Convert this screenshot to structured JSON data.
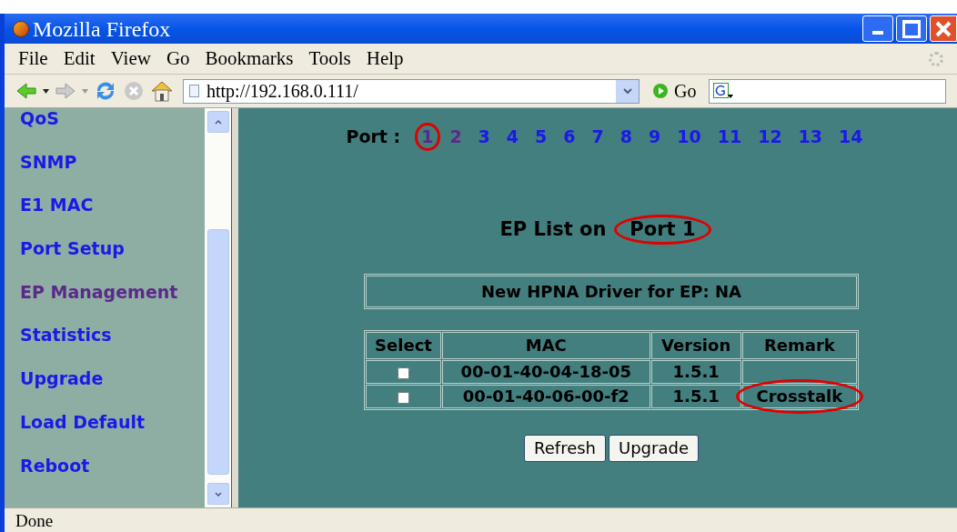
{
  "window": {
    "title": "Mozilla Firefox"
  },
  "menu": [
    "File",
    "Edit",
    "View",
    "Go",
    "Bookmarks",
    "Tools",
    "Help"
  ],
  "toolbar": {
    "url": "http://192.168.0.111/",
    "go_label": "Go"
  },
  "sidebar": {
    "items": [
      {
        "label": "QoS",
        "visited": false
      },
      {
        "label": "SNMP",
        "visited": false
      },
      {
        "label": "E1 MAC",
        "visited": false
      },
      {
        "label": "Port Setup",
        "visited": false
      },
      {
        "label": "EP Management",
        "visited": true
      },
      {
        "label": "Statistics",
        "visited": false
      },
      {
        "label": "Upgrade",
        "visited": false
      },
      {
        "label": "Load Default",
        "visited": false
      },
      {
        "label": "Reboot",
        "visited": false
      }
    ]
  },
  "ports": {
    "label": "Port :",
    "items": [
      {
        "label": "1",
        "visited": true,
        "circled": true
      },
      {
        "label": "2",
        "visited": true,
        "circled": false
      },
      {
        "label": "3",
        "visited": false,
        "circled": false
      },
      {
        "label": "4",
        "visited": false,
        "circled": false
      },
      {
        "label": "5",
        "visited": false,
        "circled": false
      },
      {
        "label": "6",
        "visited": false,
        "circled": false
      },
      {
        "label": "7",
        "visited": false,
        "circled": false
      },
      {
        "label": "8",
        "visited": false,
        "circled": false
      },
      {
        "label": "9",
        "visited": false,
        "circled": false
      },
      {
        "label": "10",
        "visited": false,
        "circled": false
      },
      {
        "label": "11",
        "visited": false,
        "circled": false
      },
      {
        "label": "12",
        "visited": false,
        "circled": false
      },
      {
        "label": "13",
        "visited": false,
        "circled": false
      },
      {
        "label": "14",
        "visited": false,
        "circled": false
      }
    ]
  },
  "heading": {
    "prefix": "EP List on",
    "port": "Port 1",
    "port_circled": true
  },
  "driver_note": "New HPNA Driver for EP: NA",
  "table": {
    "columns": [
      "Select",
      "MAC",
      "Version",
      "Remark"
    ],
    "rows": [
      {
        "checked": false,
        "mac": "00-01-40-04-18-05",
        "version": "1.5.1",
        "remark": "",
        "remark_circled": false
      },
      {
        "checked": false,
        "mac": "00-01-40-06-00-f2",
        "version": "1.5.1",
        "remark": "Crosstalk",
        "remark_circled": true
      }
    ]
  },
  "buttons": [
    "Refresh",
    "Upgrade"
  ],
  "status_bar": "Done"
}
